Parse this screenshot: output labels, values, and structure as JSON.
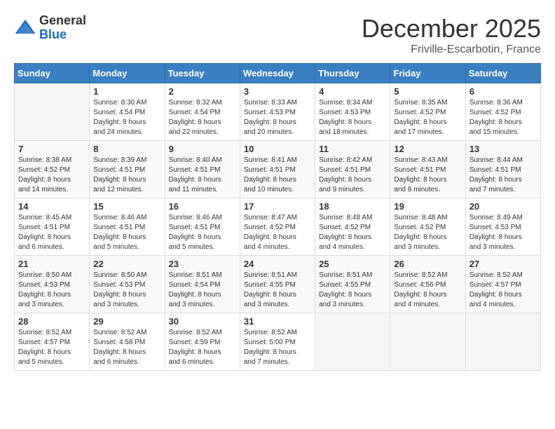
{
  "header": {
    "logo_general": "General",
    "logo_blue": "Blue",
    "month_title": "December 2025",
    "location": "Friville-Escarbotin, France"
  },
  "days_of_week": [
    "Sunday",
    "Monday",
    "Tuesday",
    "Wednesday",
    "Thursday",
    "Friday",
    "Saturday"
  ],
  "weeks": [
    [
      {
        "day": "",
        "info": ""
      },
      {
        "day": "1",
        "info": "Sunrise: 8:30 AM\nSunset: 4:54 PM\nDaylight: 8 hours\nand 24 minutes."
      },
      {
        "day": "2",
        "info": "Sunrise: 8:32 AM\nSunset: 4:54 PM\nDaylight: 8 hours\nand 22 minutes."
      },
      {
        "day": "3",
        "info": "Sunrise: 8:33 AM\nSunset: 4:53 PM\nDaylight: 8 hours\nand 20 minutes."
      },
      {
        "day": "4",
        "info": "Sunrise: 8:34 AM\nSunset: 4:53 PM\nDaylight: 8 hours\nand 18 minutes."
      },
      {
        "day": "5",
        "info": "Sunrise: 8:35 AM\nSunset: 4:52 PM\nDaylight: 8 hours\nand 17 minutes."
      },
      {
        "day": "6",
        "info": "Sunrise: 8:36 AM\nSunset: 4:52 PM\nDaylight: 8 hours\nand 15 minutes."
      }
    ],
    [
      {
        "day": "7",
        "info": "Sunrise: 8:38 AM\nSunset: 4:52 PM\nDaylight: 8 hours\nand 14 minutes."
      },
      {
        "day": "8",
        "info": "Sunrise: 8:39 AM\nSunset: 4:51 PM\nDaylight: 8 hours\nand 12 minutes."
      },
      {
        "day": "9",
        "info": "Sunrise: 8:40 AM\nSunset: 4:51 PM\nDaylight: 8 hours\nand 11 minutes."
      },
      {
        "day": "10",
        "info": "Sunrise: 8:41 AM\nSunset: 4:51 PM\nDaylight: 8 hours\nand 10 minutes."
      },
      {
        "day": "11",
        "info": "Sunrise: 8:42 AM\nSunset: 4:51 PM\nDaylight: 8 hours\nand 9 minutes."
      },
      {
        "day": "12",
        "info": "Sunrise: 8:43 AM\nSunset: 4:51 PM\nDaylight: 8 hours\nand 8 minutes."
      },
      {
        "day": "13",
        "info": "Sunrise: 8:44 AM\nSunset: 4:51 PM\nDaylight: 8 hours\nand 7 minutes."
      }
    ],
    [
      {
        "day": "14",
        "info": "Sunrise: 8:45 AM\nSunset: 4:51 PM\nDaylight: 8 hours\nand 6 minutes."
      },
      {
        "day": "15",
        "info": "Sunrise: 8:46 AM\nSunset: 4:51 PM\nDaylight: 8 hours\nand 5 minutes."
      },
      {
        "day": "16",
        "info": "Sunrise: 8:46 AM\nSunset: 4:51 PM\nDaylight: 8 hours\nand 5 minutes."
      },
      {
        "day": "17",
        "info": "Sunrise: 8:47 AM\nSunset: 4:52 PM\nDaylight: 8 hours\nand 4 minutes."
      },
      {
        "day": "18",
        "info": "Sunrise: 8:48 AM\nSunset: 4:52 PM\nDaylight: 8 hours\nand 4 minutes."
      },
      {
        "day": "19",
        "info": "Sunrise: 8:48 AM\nSunset: 4:52 PM\nDaylight: 8 hours\nand 3 minutes."
      },
      {
        "day": "20",
        "info": "Sunrise: 8:49 AM\nSunset: 4:53 PM\nDaylight: 8 hours\nand 3 minutes."
      }
    ],
    [
      {
        "day": "21",
        "info": "Sunrise: 8:50 AM\nSunset: 4:53 PM\nDaylight: 8 hours\nand 3 minutes."
      },
      {
        "day": "22",
        "info": "Sunrise: 8:50 AM\nSunset: 4:53 PM\nDaylight: 8 hours\nand 3 minutes."
      },
      {
        "day": "23",
        "info": "Sunrise: 8:51 AM\nSunset: 4:54 PM\nDaylight: 8 hours\nand 3 minutes."
      },
      {
        "day": "24",
        "info": "Sunrise: 8:51 AM\nSunset: 4:55 PM\nDaylight: 8 hours\nand 3 minutes."
      },
      {
        "day": "25",
        "info": "Sunrise: 8:51 AM\nSunset: 4:55 PM\nDaylight: 8 hours\nand 3 minutes."
      },
      {
        "day": "26",
        "info": "Sunrise: 8:52 AM\nSunset: 4:56 PM\nDaylight: 8 hours\nand 4 minutes."
      },
      {
        "day": "27",
        "info": "Sunrise: 8:52 AM\nSunset: 4:57 PM\nDaylight: 8 hours\nand 4 minutes."
      }
    ],
    [
      {
        "day": "28",
        "info": "Sunrise: 8:52 AM\nSunset: 4:57 PM\nDaylight: 8 hours\nand 5 minutes."
      },
      {
        "day": "29",
        "info": "Sunrise: 8:52 AM\nSunset: 4:58 PM\nDaylight: 8 hours\nand 6 minutes."
      },
      {
        "day": "30",
        "info": "Sunrise: 8:52 AM\nSunset: 4:59 PM\nDaylight: 8 hours\nand 6 minutes."
      },
      {
        "day": "31",
        "info": "Sunrise: 8:52 AM\nSunset: 5:00 PM\nDaylight: 8 hours\nand 7 minutes."
      },
      {
        "day": "",
        "info": ""
      },
      {
        "day": "",
        "info": ""
      },
      {
        "day": "",
        "info": ""
      }
    ]
  ]
}
